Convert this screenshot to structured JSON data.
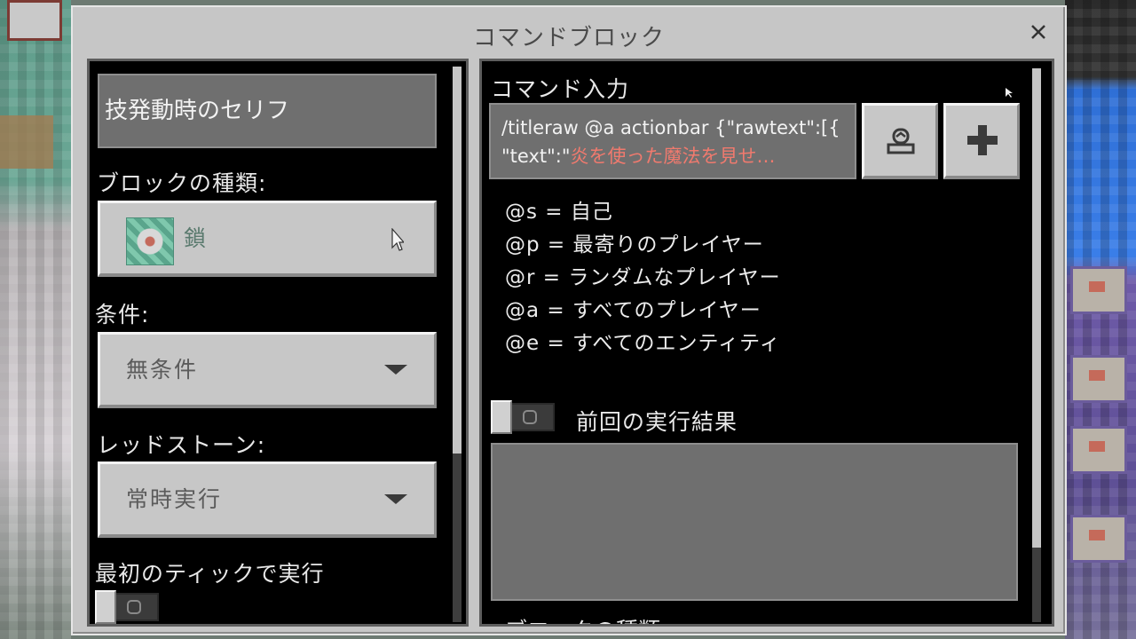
{
  "dialog": {
    "title": "コマンドブロック",
    "close_icon": "close-icon"
  },
  "left_panel": {
    "block_name": "技発動時のセリフ",
    "block_type": {
      "label": "ブロックの種類:",
      "value": "鎖",
      "icon": "chain-command-block-icon"
    },
    "condition": {
      "label": "条件:",
      "value": "無条件"
    },
    "redstone": {
      "label": "レッドストーン:",
      "value": "常時実行"
    },
    "first_tick": {
      "label": "最初のティックで実行",
      "toggle_on": false
    }
  },
  "right_panel": {
    "command_label": "コマンド入力",
    "command_line1": "/titleraw @a actionbar {\"rawtext\":[{",
    "command_line2_prefix": "\"text\":\"",
    "command_line2_highlight": "炎を使った魔法を見せ…",
    "export_icon": "export-icon",
    "add_icon": "plus-icon",
    "selector_help": [
      "@s = 自己",
      "@p = 最寄りのプレイヤー",
      "@r = ランダムなプレイヤー",
      "@a = すべてのプレイヤー",
      "@e = すべてのエンティティ"
    ],
    "previous_output": {
      "label": "前回の実行結果",
      "toggle_on": false,
      "value": ""
    },
    "cut_off_label": "ブロックの種類"
  },
  "colors": {
    "panel_bg": "#000000",
    "dialog_bg": "#c6c6c6",
    "field_bg": "#6f6f6f",
    "highlight_text": "#f07a6e"
  }
}
